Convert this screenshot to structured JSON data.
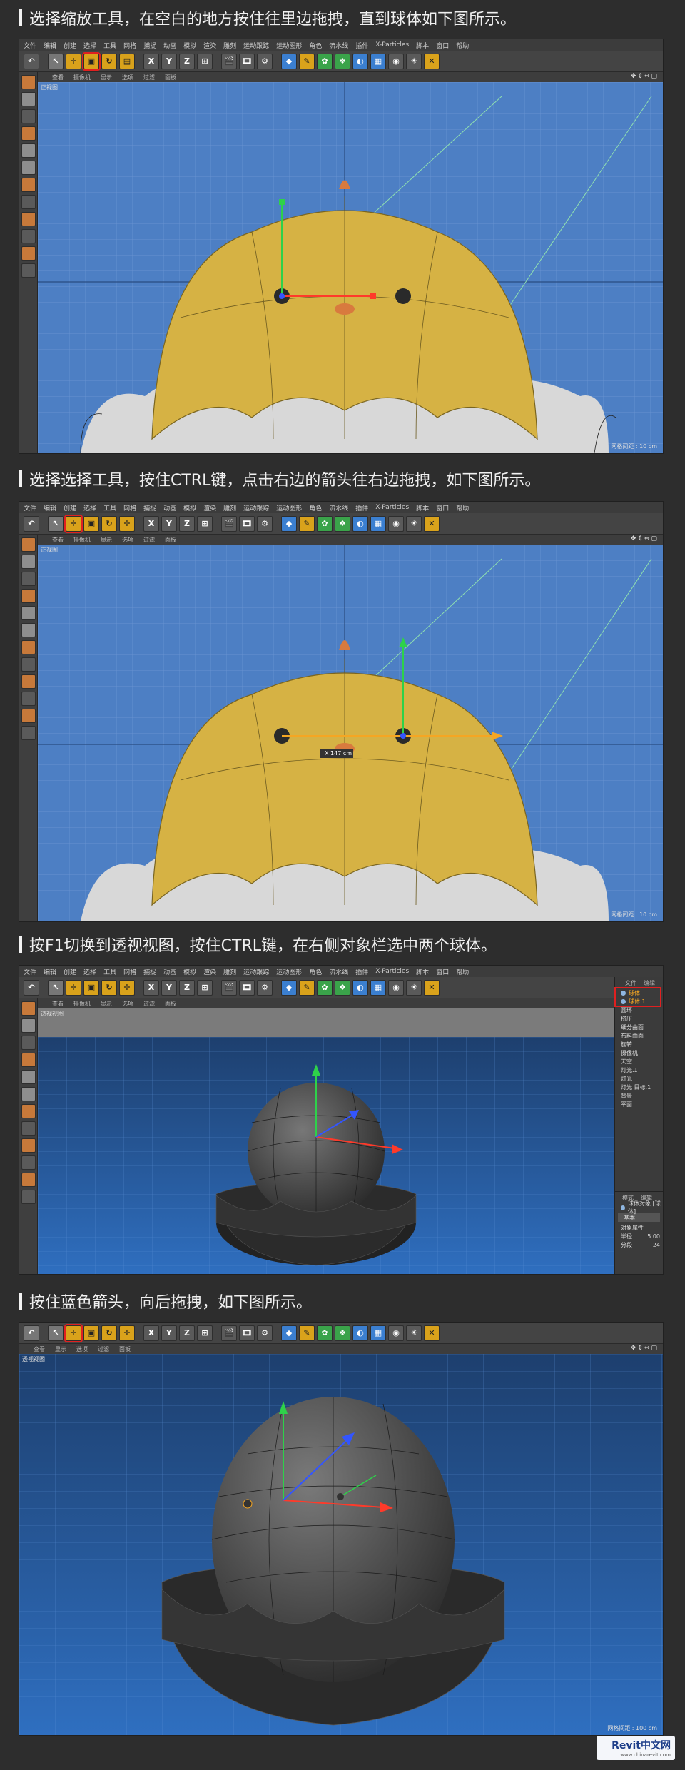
{
  "steps": [
    "选择缩放工具，在空白的地方按住往里边拖拽，直到球体如下图所示。",
    "选择选择工具，按住CTRL键，点击右边的箭头往右边拖拽，如下图所示。",
    "按F1切换到透视视图，按住CTRL键，在右侧对象栏选中两个球体。",
    "按住蓝色箭头，向后拖拽，如下图所示。"
  ],
  "menu": [
    "文件",
    "编辑",
    "创建",
    "选择",
    "工具",
    "网格",
    "捕捉",
    "动画",
    "模拟",
    "渲染",
    "雕刻",
    "运动跟踪",
    "运动图形",
    "角色",
    "流水线",
    "插件",
    "X-Particles",
    "脚本",
    "窗口",
    "帮助"
  ],
  "viewport_menu": [
    "查看",
    "摄像机",
    "显示",
    "选项",
    "过滤",
    "面板"
  ],
  "toolbar_letters": {
    "x": "X",
    "y": "Y",
    "z": "Z"
  },
  "view_front": "正视图",
  "view_persp": "透视视图",
  "grid_spacing_10": "网格间距 : 10 cm",
  "grid_spacing_100": "网格间距 : 100 cm",
  "drag_readout": "X 147 cm",
  "objects_panel": {
    "tabs": [
      "文件",
      "编辑"
    ],
    "items": [
      "球体",
      "球体.1",
      "圆环",
      "挤压",
      "细分曲面",
      "布料曲面",
      "旋转",
      "摄像机",
      "天空",
      "灯光.1",
      "灯光",
      "灯光 目标.1",
      "背景",
      "平面"
    ],
    "attr_tabs": [
      "模式",
      "编辑"
    ],
    "attr_title": "球体对象 [球体]",
    "attr_basic": "基本",
    "attr_section": "对象属性",
    "attr_rows": [
      {
        "label": "半径",
        "value": "5.00"
      },
      {
        "label": "分段",
        "value": "24"
      }
    ]
  },
  "watermark": {
    "brand": "Revit中文网",
    "url": "www.chinarevit.com"
  },
  "colors": {
    "viewport_blue": "#4d7fc4",
    "chick_yellow": "#d6b244",
    "highlight_red": "#e02020"
  }
}
